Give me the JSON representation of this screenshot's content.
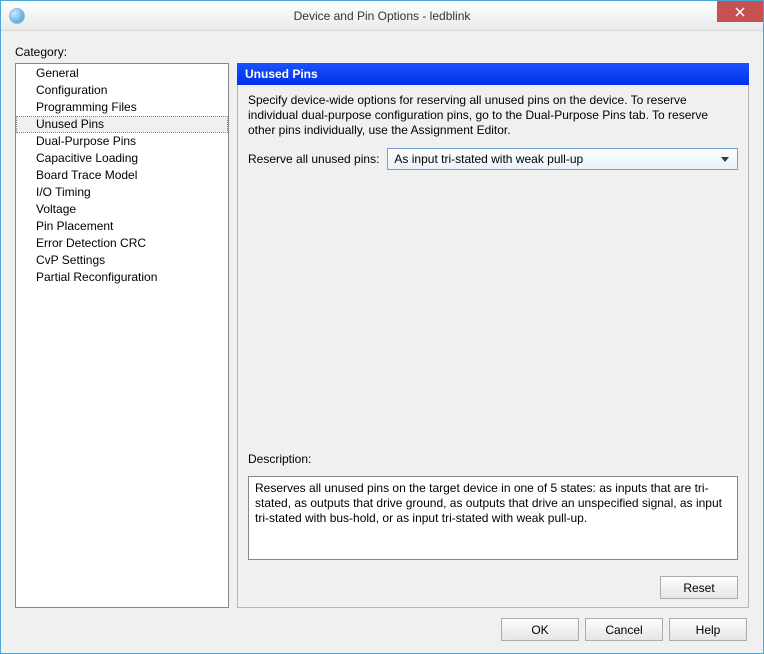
{
  "window": {
    "title": "Device and Pin Options - ledblink"
  },
  "category": {
    "label": "Category:",
    "selected_index": 3,
    "items": [
      "General",
      "Configuration",
      "Programming Files",
      "Unused Pins",
      "Dual-Purpose Pins",
      "Capacitive Loading",
      "Board Trace Model",
      "I/O Timing",
      "Voltage",
      "Pin Placement",
      "Error Detection CRC",
      "CvP Settings",
      "Partial Reconfiguration"
    ]
  },
  "panel": {
    "title": "Unused Pins",
    "intro": "Specify device-wide options for reserving all unused pins on the device. To reserve individual dual-purpose configuration pins, go to the Dual-Purpose Pins tab. To reserve other pins individually, use the Assignment Editor.",
    "reserve_label": "Reserve all unused pins:",
    "reserve_value": "As input tri-stated with weak pull-up",
    "description_label": "Description:",
    "description_text": "Reserves all unused pins on the target device in one of 5 states: as inputs that are tri-stated, as outputs that drive ground, as outputs that drive an unspecified signal, as input tri-stated with bus-hold, or as input tri-stated with weak pull-up.",
    "reset_label": "Reset"
  },
  "footer": {
    "ok": "OK",
    "cancel": "Cancel",
    "help": "Help"
  }
}
